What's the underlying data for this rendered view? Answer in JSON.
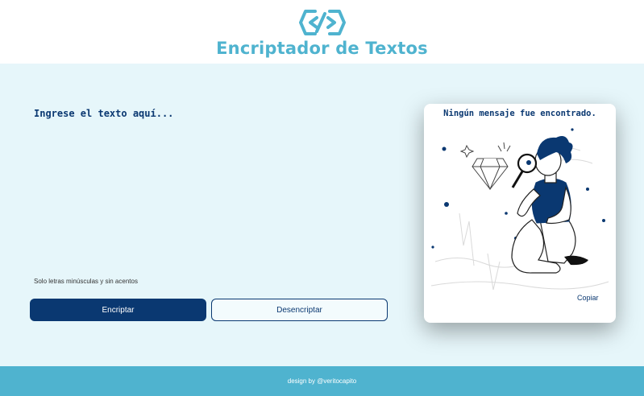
{
  "header": {
    "logo_icon": "code-brackets-logo-icon",
    "title": "Encriptador de Textos"
  },
  "input": {
    "placeholder": "Ingrese el texto aquí...",
    "value": ""
  },
  "hint": "Solo letras minúsculas y sin acentos",
  "buttons": {
    "encrypt_label": "Encriptar",
    "decrypt_label": "Desencriptar"
  },
  "output_panel": {
    "title": "Ningún mensaje fue encontrado.",
    "illustration": "person-with-magnifier-illustration",
    "copy_label": "Copiar"
  },
  "footer": {
    "text": "design by @veritocapito"
  },
  "colors": {
    "accent": "#4fb3cf",
    "primary": "#0a3871",
    "background": "#e6f6fa"
  }
}
